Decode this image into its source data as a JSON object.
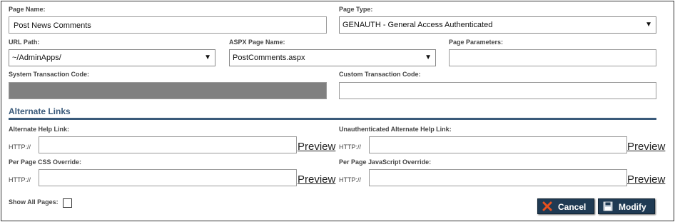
{
  "labels": {
    "page_name": "Page Name:",
    "page_type": "Page Type:",
    "url_path": "URL Path:",
    "aspx_page_name": "ASPX Page Name:",
    "page_parameters": "Page Parameters:",
    "system_transaction_code": "System Transaction Code:",
    "custom_transaction_code": "Custom Transaction Code:",
    "alternate_links_section": "Alternate Links",
    "alternate_help_link": "Alternate Help Link:",
    "unauth_alternate_help_link": "Unauthenticated Alternate Help Link:",
    "per_page_css": "Per Page CSS Override:",
    "per_page_js": "Per Page JavaScript Override:",
    "show_all_pages": "Show All Pages:"
  },
  "values": {
    "page_name": "Post News Comments",
    "page_type": "GENAUTH - General Access Authenticated",
    "url_path": "~/AdminApps/",
    "aspx_page_name": "PostComments.aspx",
    "page_parameters": "",
    "system_transaction_code": "",
    "custom_transaction_code": "",
    "alternate_help_link": "",
    "unauth_alternate_help_link": "",
    "per_page_css": "",
    "per_page_js": "",
    "show_all_pages": false
  },
  "common": {
    "http_prefix": "HTTP://",
    "preview": "Preview"
  },
  "buttons": {
    "cancel": "Cancel",
    "modify": "Modify"
  },
  "icons": {
    "dropdown": "chevron-down-icon",
    "cancel": "x-icon",
    "modify": "save-disk-icon"
  },
  "colors": {
    "section_accent": "#3a5a7a",
    "button_bg": "#1f3a53",
    "cancel_icon": "#e8501e",
    "disabled_field": "#808080"
  }
}
